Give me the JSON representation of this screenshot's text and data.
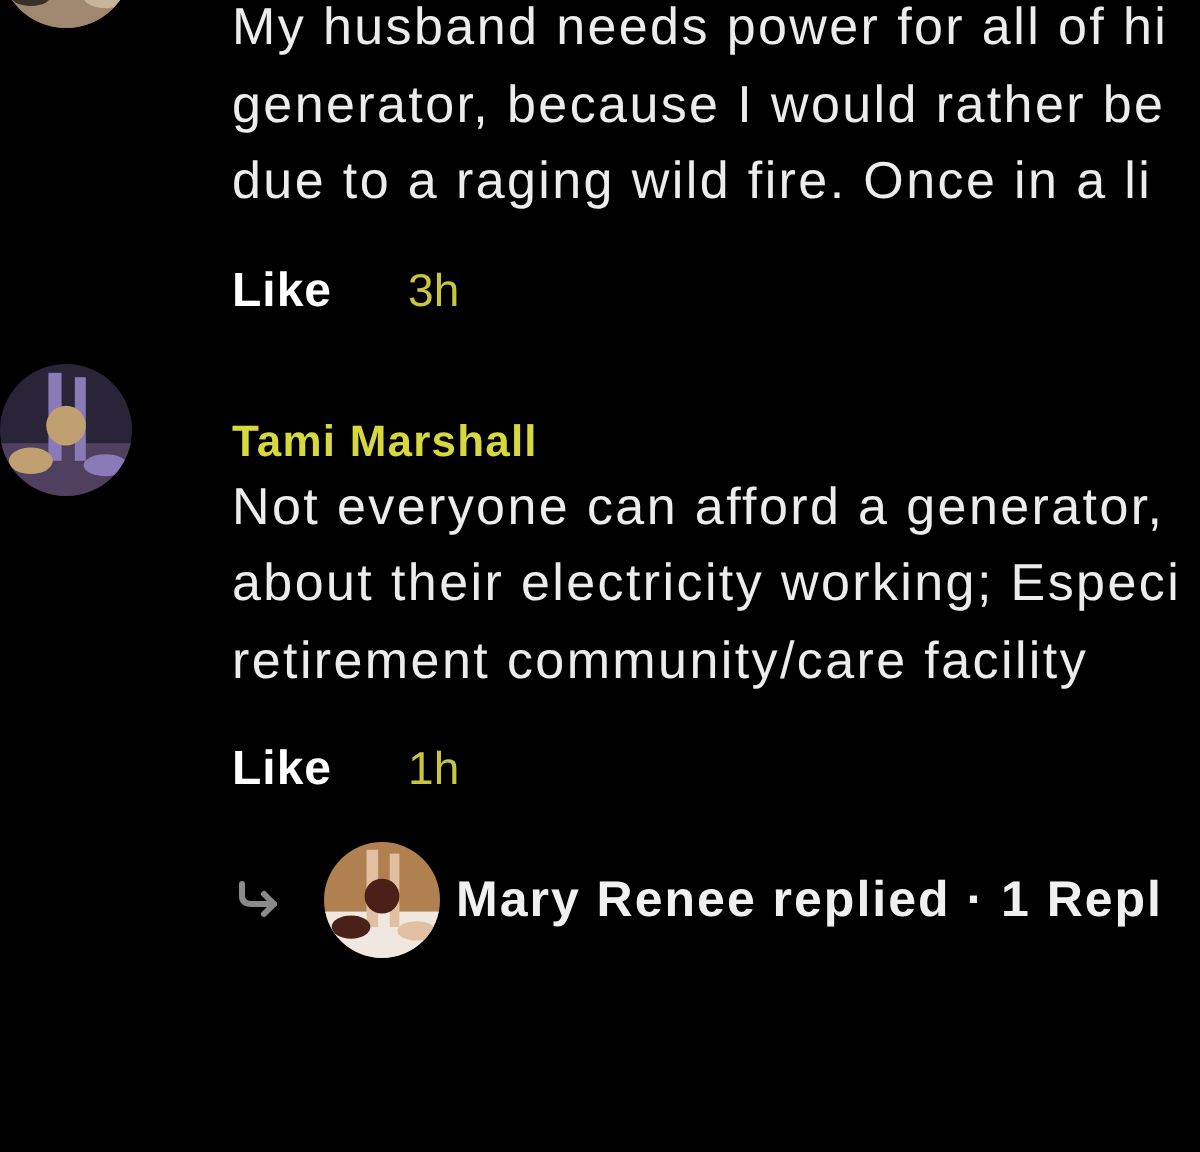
{
  "comments": [
    {
      "lines": [
        "My husband needs power for all of hi",
        "generator, because I would rather be",
        "due to a raging wild fire. Once in a li"
      ],
      "like": "Like",
      "time": "3h"
    },
    {
      "name": "Tami Marshall",
      "lines": [
        "Not everyone can afford a generator,",
        "about their electricity working; Especi",
        "retirement community/care facility"
      ],
      "like": "Like",
      "time": "1h",
      "reply": {
        "text": "Mary Renee replied · 1 Repl"
      }
    }
  ]
}
